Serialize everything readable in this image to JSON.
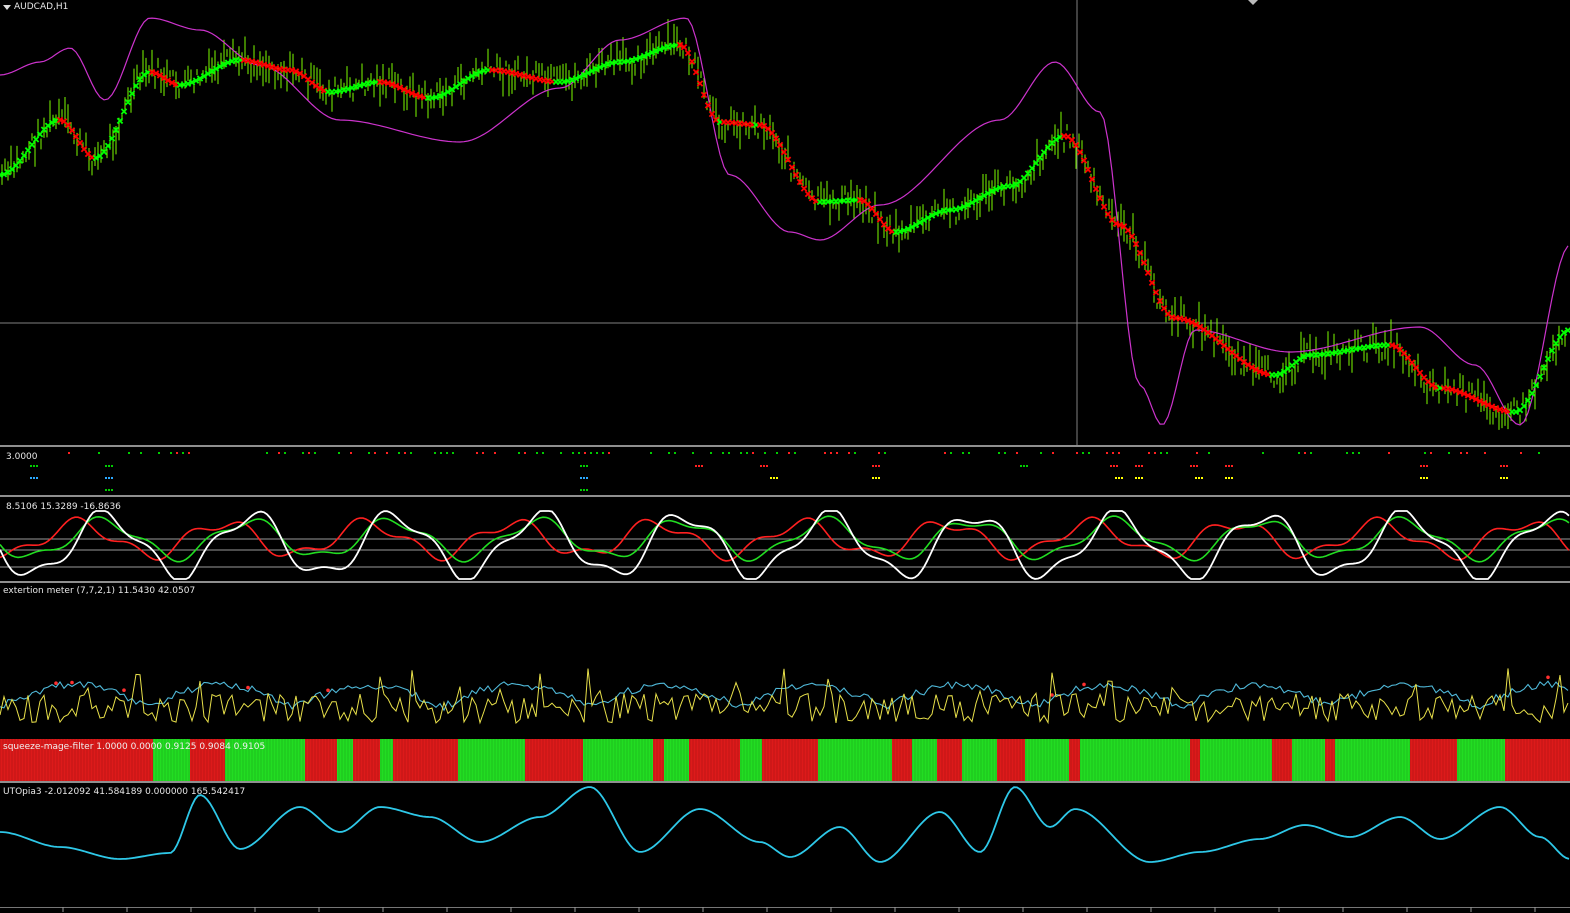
{
  "chart_window": {
    "symbol_title": "AUDCAD,H1",
    "dropdown_icon": "triangle-down-icon",
    "colors": {
      "background": "#000000",
      "bull_candle": "#7CFC00",
      "trend_up_marker": "#00FF00",
      "trend_down_marker": "#FF0000",
      "envelope_line": "#CC33CC",
      "crosshair": "#808080"
    }
  },
  "subwindows": {
    "signals": {
      "label": "3.0000",
      "colors": [
        "#00cc00",
        "#ff2020",
        "#2aa8ff",
        "#ffff00"
      ]
    },
    "oscillator": {
      "label": "8.5106 15.3289 -16.8636",
      "colors": [
        "#ff2020",
        "#22dd22",
        "#ffffff"
      ]
    },
    "extertion": {
      "label": "extertion meter (7,7,2,1) 11.5430 42.0507",
      "colors": [
        "#4fb8d8",
        "#e8e04a",
        "#ff3030"
      ]
    },
    "squeeze": {
      "label": "squeeze-mage-filter 1.0000 0.0000 0.9125 0.9084 0.9105",
      "colors": {
        "on": "#22dd22",
        "off": "#dd1a1a"
      },
      "blocks": [
        "off",
        "on",
        "off",
        "on",
        "off",
        "on",
        "off",
        "on",
        "off",
        "on",
        "off",
        "on",
        "off",
        "on",
        "off",
        "on",
        "off",
        "on",
        "off",
        "on",
        "off",
        "on",
        "off",
        "on",
        "off",
        "on",
        "off",
        "on",
        "off",
        "on",
        "off",
        "on",
        "off",
        "on"
      ]
    },
    "utopia": {
      "label": "UTOpia3 -2.012092 41.584189 0.000000 165.542417",
      "color": "#2ec8e8"
    }
  }
}
